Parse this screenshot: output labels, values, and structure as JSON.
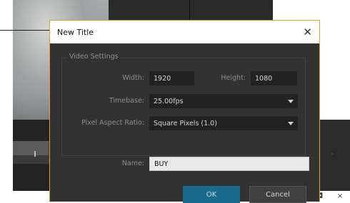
{
  "dialog": {
    "title": "New Title",
    "close_glyph": "✕",
    "video_settings": {
      "legend": "Video Settings",
      "width_label": "Width:",
      "width_value": "1920",
      "height_label": "Height:",
      "height_value": "1080",
      "timebase_label": "Timebase:",
      "timebase_value": "25.00fps",
      "par_label": "Pixel Aspect Ratio:",
      "par_value": "Square Pixels (1.0)"
    },
    "name_label": "Name:",
    "name_value": "BUY",
    "ok_label": "OK",
    "cancel_label": "Cancel"
  },
  "window_controls": {
    "minimize": "–",
    "maximize": "◘",
    "close": "×"
  },
  "colors": {
    "dialog_bg": "#323232",
    "dialog_border": "#d8a128",
    "ok_button": "#196a8d"
  }
}
